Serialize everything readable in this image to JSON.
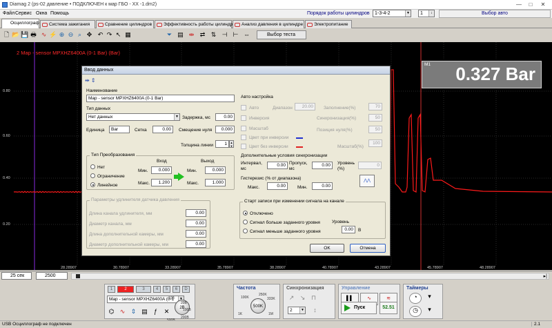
{
  "window": {
    "title": "Diamag 2 (ps-02 давление • ПОДКЛЮЧЕН к мар ГБО - XX -1.dm2)",
    "min": "—",
    "max": "□",
    "close": "✕"
  },
  "menu": {
    "items": [
      "Файл",
      "Сервис",
      "Окна",
      "Помощь"
    ],
    "order_label": "Порядок работы цилиндров",
    "order_value": "1-3-4-2",
    "cyl_value": "1",
    "auto_button": "Выбор авто"
  },
  "tabs": [
    {
      "label": "Осциллограф",
      "active": true
    },
    {
      "label": "Система зажигания",
      "active": false
    },
    {
      "label": "Сравнение цилиндров",
      "active": false
    },
    {
      "label": "Эффективность работы цилиндров",
      "active": false
    },
    {
      "label": "Анализ давления в цилиндре",
      "active": false
    },
    {
      "label": "Электропитание",
      "active": false
    }
  ],
  "toolbar": {
    "select_test": "Выбор теста",
    "icons": [
      "new-file-icon",
      "open-file-icon",
      "save-icon",
      "print-icon",
      "channel-wave-icon",
      "trigger-icon",
      "zoom-in-icon",
      "zoom-out-icon",
      "zoom-area-icon",
      "pan-icon",
      "undo-icon",
      "redo-icon",
      "cursor-icon",
      "grid-icon",
      "filter-icon",
      "table-icon",
      "marker-icon",
      "spread-icon"
    ]
  },
  "scope": {
    "channel_title": "2 Map - sensor MPXHZ6400A (0-1 Bar) (Bar)",
    "y_ticks": [
      "0.80",
      "0.60",
      "0.40",
      "0.20"
    ],
    "x_ticks": [
      "28.28907",
      "30.78907",
      "33.28907",
      "35.78907",
      "38.28907",
      "40.78907",
      "43.28907",
      "45.78907",
      "48.28907"
    ],
    "marker_label": "M1",
    "marker_value": "0.327 Bar",
    "trace_color": "#ff1a1a",
    "background": "#000000"
  },
  "hscroll": {
    "timebase": "25 сек",
    "samples": "2500"
  },
  "bottom": {
    "channels": [
      "1",
      "2",
      "3",
      "4",
      "5",
      "6",
      "D"
    ],
    "active_channel": "2",
    "channel_sensor": "Map - sensor MPXHZ6400A (0-1",
    "frequency_label": "Частота",
    "sync_label": "Синхронизация",
    "sync_value": "2",
    "control_label": "Управление",
    "start_label": "Пуск",
    "counter_value": "52.51",
    "timers_label": "Таймеры",
    "volt_knob": {
      "center": "2В",
      "labels": [
        "0.1В",
        "1В",
        "10В",
        "20В",
        "100В",
        "200В",
        "500В"
      ]
    },
    "freq_knob": {
      "center": "500K",
      "labels": [
        "1K",
        "100K",
        "250K",
        "333K",
        "1M"
      ]
    }
  },
  "dialog": {
    "title": "Ввод данных",
    "name_label": "Наименование",
    "name_value": "Map - sensor MPXHZ6400A (0-1 Bar)",
    "data_type_label": "Тип данных",
    "data_type_value": "Нет данных",
    "delay_label": "Задержка, мс",
    "delay_value": "0.00",
    "unit_label": "Единица",
    "unit_value": "Bar",
    "grid_label": "Сетка",
    "grid_value": "0.00",
    "zero_label": "Смещение нуля",
    "zero_value": "0.000",
    "line_label": "Толщина линии",
    "line_value": "1",
    "transform": {
      "title": "Тип Преобразования",
      "options": [
        "Нет",
        "Ограничение",
        "Линейное"
      ],
      "selected": "Линейное",
      "in_label": "Вход",
      "out_label": "Выход",
      "min_label": "Мин.",
      "max_label": "Макс.",
      "in_min": "0.000",
      "in_max": "1.200",
      "out_min": "0.000",
      "out_max": "1.000"
    },
    "extension": {
      "title": "Параметры удлинителя датчика давления",
      "rows": [
        {
          "label": "Длина канала удлинителя, мм",
          "value": "0.00"
        },
        {
          "label": "Диаметр канала, мм",
          "value": "0.00"
        },
        {
          "label": "Длина дополнительной камеры, мм",
          "value": "0.00"
        },
        {
          "label": "Диаметр дополнительной камеры, мм",
          "value": "0.00"
        }
      ]
    },
    "auto": {
      "title": "Авто настройка",
      "auto_label": "Авто",
      "range_label": "Диапазон",
      "range_value": "20.00",
      "fill_label": "Заполнение(%)",
      "fill_value": "70",
      "inversion_label": "Инверсия",
      "sync_label": "Синхронизация(%)",
      "sync_value": "50",
      "scale_label": "Масштаб",
      "zero_pos_label": "Позиция нуля(%)",
      "zero_pos_value": "50",
      "color_inv_label": "Цвет при инверсии",
      "color_noinv_label": "Цвет без инверсии",
      "color_inv": "#2030d0",
      "color_noinv": "#e02020",
      "scale_pct_label": "Масштаб(%)",
      "scale_pct_value": "100"
    },
    "sync_extra": {
      "title": "Дополнительные условия синхронизации",
      "interval_label": "Интервал, мс",
      "interval_value": "0.00",
      "skip_label": "Пропуск, мс",
      "skip_value": "0.00",
      "level_label": "Уровень (%)",
      "level_value": "0",
      "hyst_label": "Гистерезис (% от диапазона)",
      "max_label": "Макс.",
      "max_value": "0.00",
      "min_label": "Мин.",
      "min_value": "0.00"
    },
    "record": {
      "title": "Старт записи при изменении сигнала на канале",
      "options": [
        "Отключено",
        "Сигнал больше заданного уровня",
        "Сигнал меньше заданного уровня"
      ],
      "selected": "Отключено",
      "level_label": "Уровень",
      "level_value": "0.00",
      "level_unit": "В"
    },
    "ok_label": "OK",
    "cancel_label": "Отмена"
  },
  "status": {
    "left": "USB Осциллограф не подключен",
    "right": "2.1"
  }
}
